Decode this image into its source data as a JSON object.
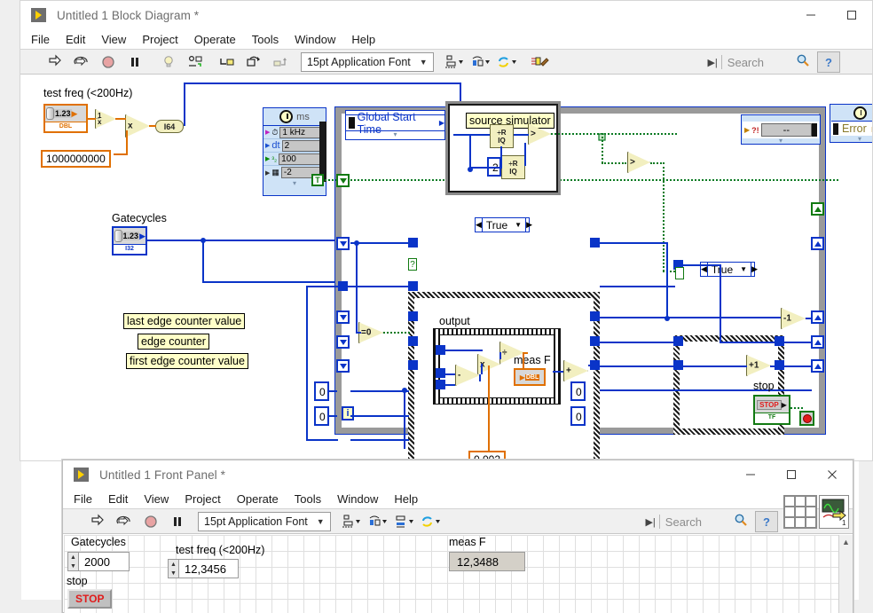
{
  "block_diagram": {
    "title": "Untitled 1 Block Diagram *",
    "menu": [
      "File",
      "Edit",
      "View",
      "Project",
      "Operate",
      "Tools",
      "Window",
      "Help"
    ],
    "toolbar": {
      "font_selector": "15pt Application Font",
      "icons": [
        "run-icon",
        "run-continuously-icon",
        "abort-icon",
        "pause-icon",
        "highlight-execution-icon",
        "retain-wire-values-icon",
        "step-into-icon",
        "step-over-icon",
        "step-out-icon",
        "align-objects-icon",
        "distribute-objects-icon",
        "reorder-icon",
        "clean-up-diagram-icon"
      ]
    },
    "search": {
      "placeholder": "Search"
    },
    "window_buttons": [
      "minimize",
      "maximize"
    ],
    "labels": {
      "test_freq": "test freq (<200Hz)",
      "gatecycles": "Gatecycles",
      "last_edge": "last edge counter value",
      "edge_counter": "edge counter",
      "first_edge": "first edge counter value",
      "source_simulator": "source simulator",
      "output": "output",
      "meas_f": "meas F",
      "stop": "stop",
      "error": "Error",
      "global_start_time": "Global Start Time"
    },
    "constants": {
      "one_billion": "1000000000",
      "coeff": "0,002",
      "zero_a": "0",
      "zero_b": "0",
      "zero_c": "0",
      "zero_d": "0",
      "two": "2"
    },
    "terminals": {
      "test_freq_type": "DBL",
      "test_freq_value": "1.23",
      "gatecycles_type": "I32",
      "gatecycles_value": "1.23",
      "i64_cast": "I64",
      "meas_f_type": "DBL",
      "stop_type": "TF",
      "stop_caption": "STOP"
    },
    "config_node": {
      "unit": "ms",
      "rows": [
        {
          "icon": "clock-source-icon",
          "value": "1 kHz"
        },
        {
          "icon": "dt-icon",
          "label": "dt",
          "value": "2"
        },
        {
          "icon": "priority-icon",
          "value": "100"
        },
        {
          "icon": "processor-icon",
          "value": "-2"
        }
      ]
    },
    "error_node": {
      "label": "Error"
    },
    "error_out_value": "--",
    "case_structures": [
      {
        "name": "main-case",
        "selector": "True"
      },
      {
        "name": "secondary-case",
        "selector": "True"
      }
    ],
    "function_nodes": [
      {
        "name": "reciprocal-node",
        "caption": "1/x"
      },
      {
        "name": "multiply-node-1",
        "caption": "x"
      },
      {
        "name": "equal-zero-node",
        "caption": "=0"
      },
      {
        "name": "subtract-node",
        "caption": "-"
      },
      {
        "name": "multiply-node-2",
        "caption": "x"
      },
      {
        "name": "divide-node",
        "caption": "÷"
      },
      {
        "name": "add-node",
        "caption": "+"
      },
      {
        "name": "decrement-node",
        "caption": "-1"
      },
      {
        "name": "increment-node",
        "caption": "+1"
      },
      {
        "name": "quotient-remainder-node-1",
        "caption": "R/IQ"
      },
      {
        "name": "quotient-remainder-node-2",
        "caption": "R/IQ"
      },
      {
        "name": "greater-node-1",
        "caption": ">"
      },
      {
        "name": "greater-node-2",
        "caption": ">"
      },
      {
        "name": "greater-node-3",
        "caption": ">"
      },
      {
        "name": "greater-node-4",
        "caption": ">"
      }
    ]
  },
  "front_panel": {
    "title": "Untitled 1 Front Panel *",
    "menu": [
      "File",
      "Edit",
      "View",
      "Project",
      "Operate",
      "Tools",
      "Window",
      "Help"
    ],
    "toolbar": {
      "font_selector": "15pt Application Font",
      "icons": [
        "run-icon",
        "run-continuously-icon",
        "abort-icon",
        "pause-icon",
        "align-objects-icon",
        "distribute-objects-icon",
        "resize-objects-icon",
        "reorder-icon"
      ]
    },
    "search": {
      "placeholder": "Search"
    },
    "window_buttons": [
      "minimize",
      "maximize",
      "close"
    ],
    "controls": [
      {
        "name": "gatecycles-control",
        "label": "Gatecycles",
        "value": "2000",
        "type": "numeric"
      },
      {
        "name": "test-freq-control",
        "label": "test freq (<200Hz)",
        "value": "12,3456",
        "type": "numeric"
      },
      {
        "name": "meas-f-indicator",
        "label": "meas F",
        "value": "12,3488",
        "type": "indicator"
      },
      {
        "name": "stop-button",
        "label": "stop",
        "value": "STOP",
        "type": "boolean"
      }
    ]
  },
  "colors": {
    "wire_blue": "#0a34c8",
    "wire_orange": "#e07000",
    "wire_green": "#0a7a22",
    "node_fill": "#f2efc0",
    "loop_border": "#9a9a9a",
    "stop_red": "#e01b1b"
  }
}
